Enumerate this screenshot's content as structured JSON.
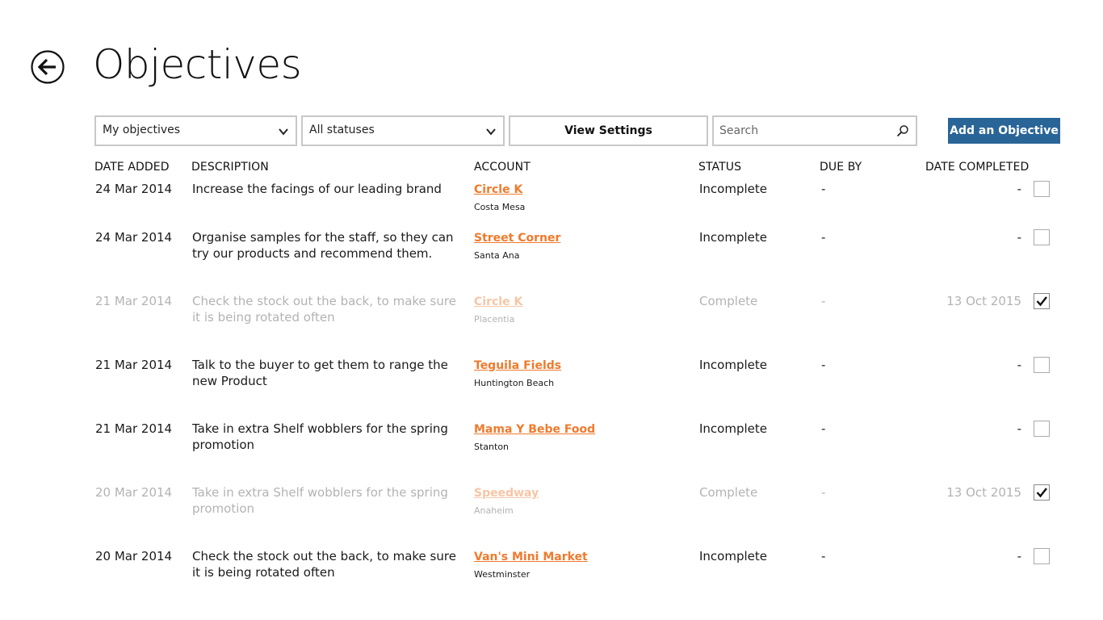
{
  "header": {
    "title": "Objectives"
  },
  "toolbar": {
    "owner_filter": "My objectives",
    "status_filter": "All statuses",
    "view_settings_label": "View Settings",
    "search_placeholder": "Search",
    "add_label": "Add an Objective",
    "accent": "#2a6597"
  },
  "columns": {
    "date_added": "DATE ADDED",
    "description": "DESCRIPTION",
    "account": "ACCOUNT",
    "status": "STATUS",
    "due_by": "DUE BY",
    "date_completed": "DATE COMPLETED"
  },
  "colors": {
    "link": "#f07a2c",
    "link_faded": "#f7c5a6",
    "faded_text": "#b3b3b3"
  },
  "rows": [
    {
      "date_added": "24 Mar 2014",
      "description": "Increase the facings of our leading brand",
      "account": "Circle K",
      "location": "Costa Mesa",
      "status": "Incomplete",
      "due_by": "-",
      "date_completed": "-",
      "checked": false
    },
    {
      "date_added": "24 Mar 2014",
      "description": "Organise samples for the staff, so they can try our products and recommend them.",
      "account": "Street Corner",
      "location": "Santa Ana",
      "status": "Incomplete",
      "due_by": "-",
      "date_completed": "-",
      "checked": false
    },
    {
      "date_added": "21 Mar 2014",
      "description": "Check the stock out the back, to make sure it is being rotated often",
      "account": "Circle K",
      "location": "Placentia",
      "status": "Complete",
      "due_by": "-",
      "date_completed": "13 Oct 2015",
      "checked": true
    },
    {
      "date_added": "21 Mar 2014",
      "description": "Talk to the buyer to get them to range the new Product",
      "account": "Teguila Fields",
      "location": "Huntington Beach",
      "status": "Incomplete",
      "due_by": "-",
      "date_completed": "-",
      "checked": false
    },
    {
      "date_added": "21 Mar 2014",
      "description": "Take in extra Shelf wobblers for the spring promotion",
      "account": "Mama Y Bebe Food",
      "location": "Stanton",
      "status": "Incomplete",
      "due_by": "-",
      "date_completed": "-",
      "checked": false
    },
    {
      "date_added": "20 Mar 2014",
      "description": "Take in extra Shelf wobblers for the spring promotion",
      "account": "Speedway",
      "location": "Anaheim",
      "status": "Complete",
      "due_by": "-",
      "date_completed": "13 Oct 2015",
      "checked": true
    },
    {
      "date_added": "20 Mar 2014",
      "description": "Check the stock out the back, to make sure it is being rotated often",
      "account": "Van's Mini Market",
      "location": "Westminster",
      "status": "Incomplete",
      "due_by": "-",
      "date_completed": "-",
      "checked": false
    }
  ]
}
